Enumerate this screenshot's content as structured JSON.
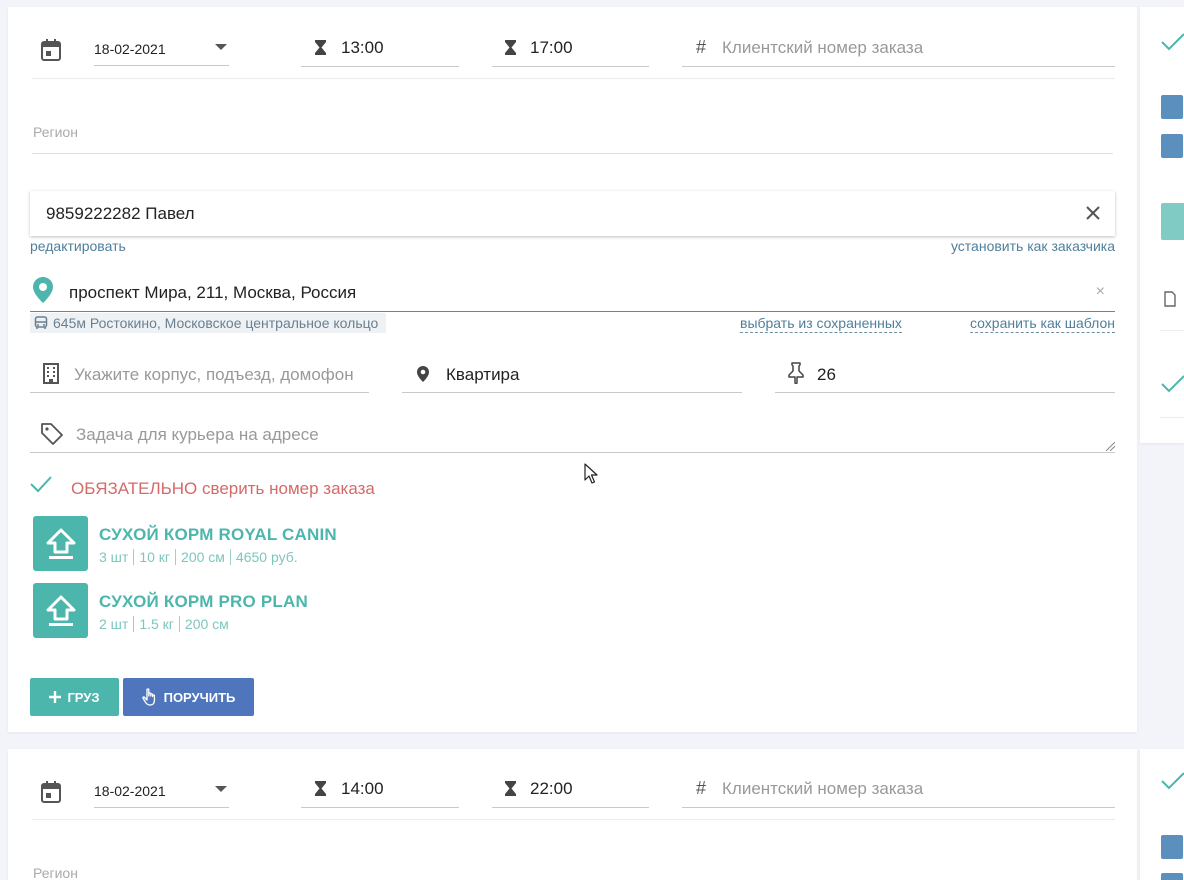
{
  "order1": {
    "date": "18-02-2021",
    "time_from": "13:00",
    "time_to": "17:00",
    "client_order_placeholder": "Клиентский номер заказа",
    "region_placeholder": "Регион",
    "contact": "9859222282 Павел",
    "edit_link": "редактировать",
    "set_customer_link": "установить как заказчика",
    "address": "проспект Мира, 211, Москва, Россия",
    "metro": "645м Ростокино, Московское центральное кольцо",
    "choose_saved_link": "выбрать из сохраненных",
    "save_template_link": "сохранить как шаблон",
    "building_placeholder": "Укажите корпус, подъезд, домофон",
    "apartment_value": "Квартира",
    "floor_value": "26",
    "task_placeholder": "Задача для курьера на адресе",
    "note": "ОБЯЗАТЕЛЬНО сверить номер заказа",
    "cargo": [
      {
        "title": "СУХОЙ КОРМ ROYAL CANIN",
        "qty": "3 шт",
        "weight": "10 кг",
        "size": "200 см",
        "price": "4650 руб."
      },
      {
        "title": "СУХОЙ КОРМ PRO PLAN",
        "qty": "2 шт",
        "weight": "1.5 кг",
        "size": "200 см"
      }
    ],
    "add_cargo_label": "ГРУЗ",
    "assign_label": "ПОРУЧИТЬ"
  },
  "order2": {
    "date": "18-02-2021",
    "time_from": "14:00",
    "time_to": "22:00",
    "client_order_placeholder": "Клиентский номер заказа",
    "region_placeholder": "Регион"
  },
  "colors": {
    "teal": "#4db6ac",
    "blue": "#4f76bd",
    "note_red": "#d46a6a",
    "side_icon": "#5b8fbd"
  }
}
